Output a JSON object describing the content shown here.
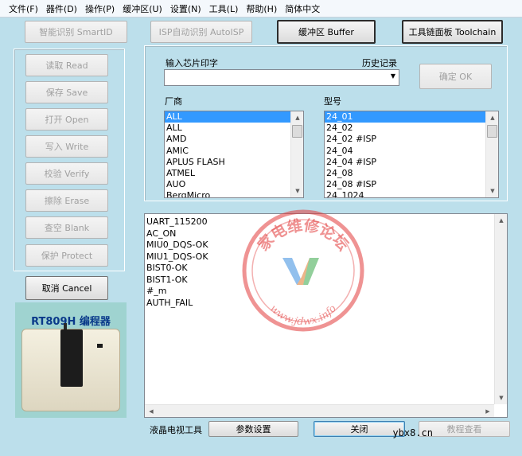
{
  "menu": [
    "文件(F)",
    "器件(D)",
    "操作(P)",
    "缓冲区(U)",
    "设置(N)",
    "工具(L)",
    "帮助(H)",
    "简体中文"
  ],
  "toolbar": {
    "smartid": "智能识别 SmartID",
    "autoisp": "ISP自动识别 AutoISP",
    "buffer": "缓冲区 Buffer",
    "toolchain": "工具链面板 Toolchain"
  },
  "ops": {
    "read": "读取 Read",
    "save": "保存 Save",
    "open": "打开 Open",
    "write": "写入 Write",
    "verify": "校验 Verify",
    "erase": "擦除 Erase",
    "blank": "查空 Blank",
    "protect": "保护 Protect",
    "cancel": "取消 Cancel"
  },
  "chip": {
    "input_label": "输入芯片印字",
    "history_label": "历史记录",
    "input_value": "",
    "ok": "确定 OK"
  },
  "vendor": {
    "label": "厂商",
    "items": [
      "ALL",
      "ALL",
      "AMD",
      "AMIC",
      "APLUS FLASH",
      "ATMEL",
      "AUO",
      "BergMicro"
    ]
  },
  "model": {
    "label": "型号",
    "items": [
      "24_01",
      "24_02",
      "24_02 #ISP",
      "24_04",
      "24_04 #ISP",
      "24_08",
      "24_08 #ISP",
      "24_1024"
    ]
  },
  "log": [
    "UART_115200",
    "AC_ON",
    "MIU0_DQS-OK",
    "MIU1_DQS-OK",
    "BIST0-OK",
    "BIST1-OK",
    "#_m",
    "AUTH_FAIL"
  ],
  "product": {
    "title": "RT809H 编程器"
  },
  "bottom": {
    "lcd_label": "液晶电视工具",
    "params": "参数设置",
    "close": "关闭",
    "tutorial": "教程查看"
  },
  "watermark": {
    "cn": "家电维修论坛",
    "url": "www.jdwx.info"
  },
  "site": "ybx8.cn",
  "colors": {
    "background": "#bcdfeb",
    "selection": "#3399ff",
    "watermark": "#e23a3a"
  }
}
